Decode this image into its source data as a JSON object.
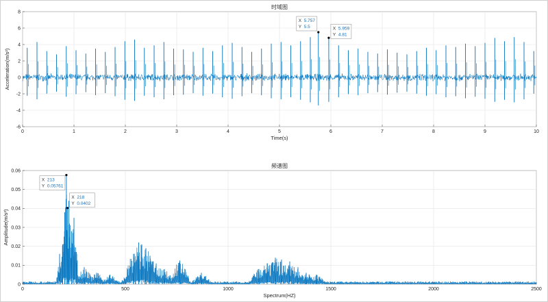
{
  "chart_data": [
    {
      "type": "line",
      "title": "时域图",
      "xlabel": "Time(s)",
      "ylabel": "Acceleration(m/s²)",
      "xlim": [
        0,
        10
      ],
      "ylim": [
        -6,
        8
      ],
      "xticks": [
        "0",
        "1",
        "2",
        "3",
        "4",
        "5",
        "6",
        "7",
        "8",
        "9",
        "10"
      ],
      "yticks": [
        "-6",
        "-4",
        "-2",
        "0",
        "2",
        "4",
        "6",
        "8"
      ],
      "grid": true,
      "color": "#0072bd",
      "series": [
        {
          "description": "vibration signal with periodic impulse spikes on a ±0.5 noise band",
          "impulse_peaks": [
            {
              "x": 0.09,
              "y": 3.6
            },
            {
              "x": 0.28,
              "y": 4.3
            },
            {
              "x": 0.47,
              "y": 3.2
            },
            {
              "x": 0.66,
              "y": 2.8
            },
            {
              "x": 0.85,
              "y": 3.8
            },
            {
              "x": 1.04,
              "y": 3.3
            },
            {
              "x": 1.23,
              "y": 2.9
            },
            {
              "x": 1.42,
              "y": 3.5
            },
            {
              "x": 1.61,
              "y": 3.1
            },
            {
              "x": 1.8,
              "y": 3.7
            },
            {
              "x": 1.99,
              "y": 4.4
            },
            {
              "x": 2.18,
              "y": 4.6
            },
            {
              "x": 2.37,
              "y": 3.6
            },
            {
              "x": 2.56,
              "y": 3.9
            },
            {
              "x": 2.75,
              "y": 4.3
            },
            {
              "x": 2.94,
              "y": 3.5
            },
            {
              "x": 3.13,
              "y": 3.4
            },
            {
              "x": 3.32,
              "y": 3.1
            },
            {
              "x": 3.51,
              "y": 3.6
            },
            {
              "x": 3.7,
              "y": 3.2
            },
            {
              "x": 3.89,
              "y": 3.9
            },
            {
              "x": 4.08,
              "y": 4.2
            },
            {
              "x": 4.27,
              "y": 3.7
            },
            {
              "x": 4.46,
              "y": 3.1
            },
            {
              "x": 4.65,
              "y": 3.5
            },
            {
              "x": 4.84,
              "y": 4.1
            },
            {
              "x": 5.03,
              "y": 4.3
            },
            {
              "x": 5.22,
              "y": 3.9
            },
            {
              "x": 5.41,
              "y": 4.4
            },
            {
              "x": 5.6,
              "y": 4.9
            },
            {
              "x": 5.757,
              "y": 5.5
            },
            {
              "x": 5.959,
              "y": 4.81
            },
            {
              "x": 6.15,
              "y": 3.9
            },
            {
              "x": 6.34,
              "y": 3.3
            },
            {
              "x": 6.53,
              "y": 3.5
            },
            {
              "x": 6.72,
              "y": 3.1
            },
            {
              "x": 6.91,
              "y": 2.9
            },
            {
              "x": 7.1,
              "y": 3.4
            },
            {
              "x": 7.29,
              "y": 3.0
            },
            {
              "x": 7.48,
              "y": 2.8
            },
            {
              "x": 7.67,
              "y": 3.2
            },
            {
              "x": 7.86,
              "y": 3.6
            },
            {
              "x": 8.05,
              "y": 3.3
            },
            {
              "x": 8.24,
              "y": 3.9
            },
            {
              "x": 8.43,
              "y": 3.7
            },
            {
              "x": 8.62,
              "y": 4.1
            },
            {
              "x": 8.81,
              "y": 3.8
            },
            {
              "x": 9.0,
              "y": 4.2
            },
            {
              "x": 9.19,
              "y": 4.8
            },
            {
              "x": 9.38,
              "y": 4.4
            },
            {
              "x": 9.57,
              "y": 4.9
            },
            {
              "x": 9.76,
              "y": 4.3
            },
            {
              "x": 9.95,
              "y": 3.2
            }
          ],
          "noise_band": [
            -0.5,
            0.5
          ]
        }
      ],
      "datatips": [
        {
          "x_label": "X",
          "x": "5.757",
          "y_label": "Y",
          "y": "5.5",
          "x_value": 5.757,
          "y_value": 5.5
        },
        {
          "x_label": "X",
          "x": "5.959",
          "y_label": "Y",
          "y": "4.81",
          "x_value": 5.959,
          "y_value": 4.81
        }
      ]
    },
    {
      "type": "line",
      "title": "频谱图",
      "xlabel": "Spectrum(HZ)",
      "ylabel": "Amplitude(m/s²)",
      "xlim": [
        0,
        2500
      ],
      "ylim": [
        0,
        0.06
      ],
      "xticks": [
        "0",
        "500",
        "1000",
        "1500",
        "2000",
        "2500"
      ],
      "yticks": [
        "0",
        "0.01",
        "0.02",
        "0.03",
        "0.04",
        "0.05",
        "0.06"
      ],
      "grid": true,
      "color": "#0072bd",
      "series": [
        {
          "description": "amplitude spectrum with a dominant cluster near 200-250 Hz and broad humps near 550-600 Hz and 1200-1300 Hz",
          "peaks": [
            {
              "x": 180,
              "y": 0.016
            },
            {
              "x": 195,
              "y": 0.021
            },
            {
              "x": 205,
              "y": 0.038
            },
            {
              "x": 213,
              "y": 0.05761
            },
            {
              "x": 218,
              "y": 0.0402
            },
            {
              "x": 225,
              "y": 0.044
            },
            {
              "x": 238,
              "y": 0.028
            },
            {
              "x": 250,
              "y": 0.035
            },
            {
              "x": 262,
              "y": 0.017
            },
            {
              "x": 300,
              "y": 0.009
            },
            {
              "x": 360,
              "y": 0.006
            },
            {
              "x": 425,
              "y": 0.005
            },
            {
              "x": 540,
              "y": 0.016
            },
            {
              "x": 565,
              "y": 0.022
            },
            {
              "x": 580,
              "y": 0.021
            },
            {
              "x": 600,
              "y": 0.019
            },
            {
              "x": 620,
              "y": 0.015
            },
            {
              "x": 650,
              "y": 0.011
            },
            {
              "x": 690,
              "y": 0.008
            },
            {
              "x": 765,
              "y": 0.0125
            },
            {
              "x": 870,
              "y": 0.006
            },
            {
              "x": 1150,
              "y": 0.008
            },
            {
              "x": 1190,
              "y": 0.011
            },
            {
              "x": 1230,
              "y": 0.014
            },
            {
              "x": 1260,
              "y": 0.013
            },
            {
              "x": 1300,
              "y": 0.012
            },
            {
              "x": 1340,
              "y": 0.009
            },
            {
              "x": 1380,
              "y": 0.006
            },
            {
              "x": 1430,
              "y": 0.005
            }
          ],
          "noise_floor": 0.0015
        }
      ],
      "datatips": [
        {
          "x_label": "X",
          "x": "213",
          "y_label": "Y",
          "y": "0.05761",
          "x_value": 213,
          "y_value": 0.05761
        },
        {
          "x_label": "X",
          "x": "218",
          "y_label": "Y",
          "y": "0.0402",
          "x_value": 218,
          "y_value": 0.0402
        }
      ]
    }
  ]
}
